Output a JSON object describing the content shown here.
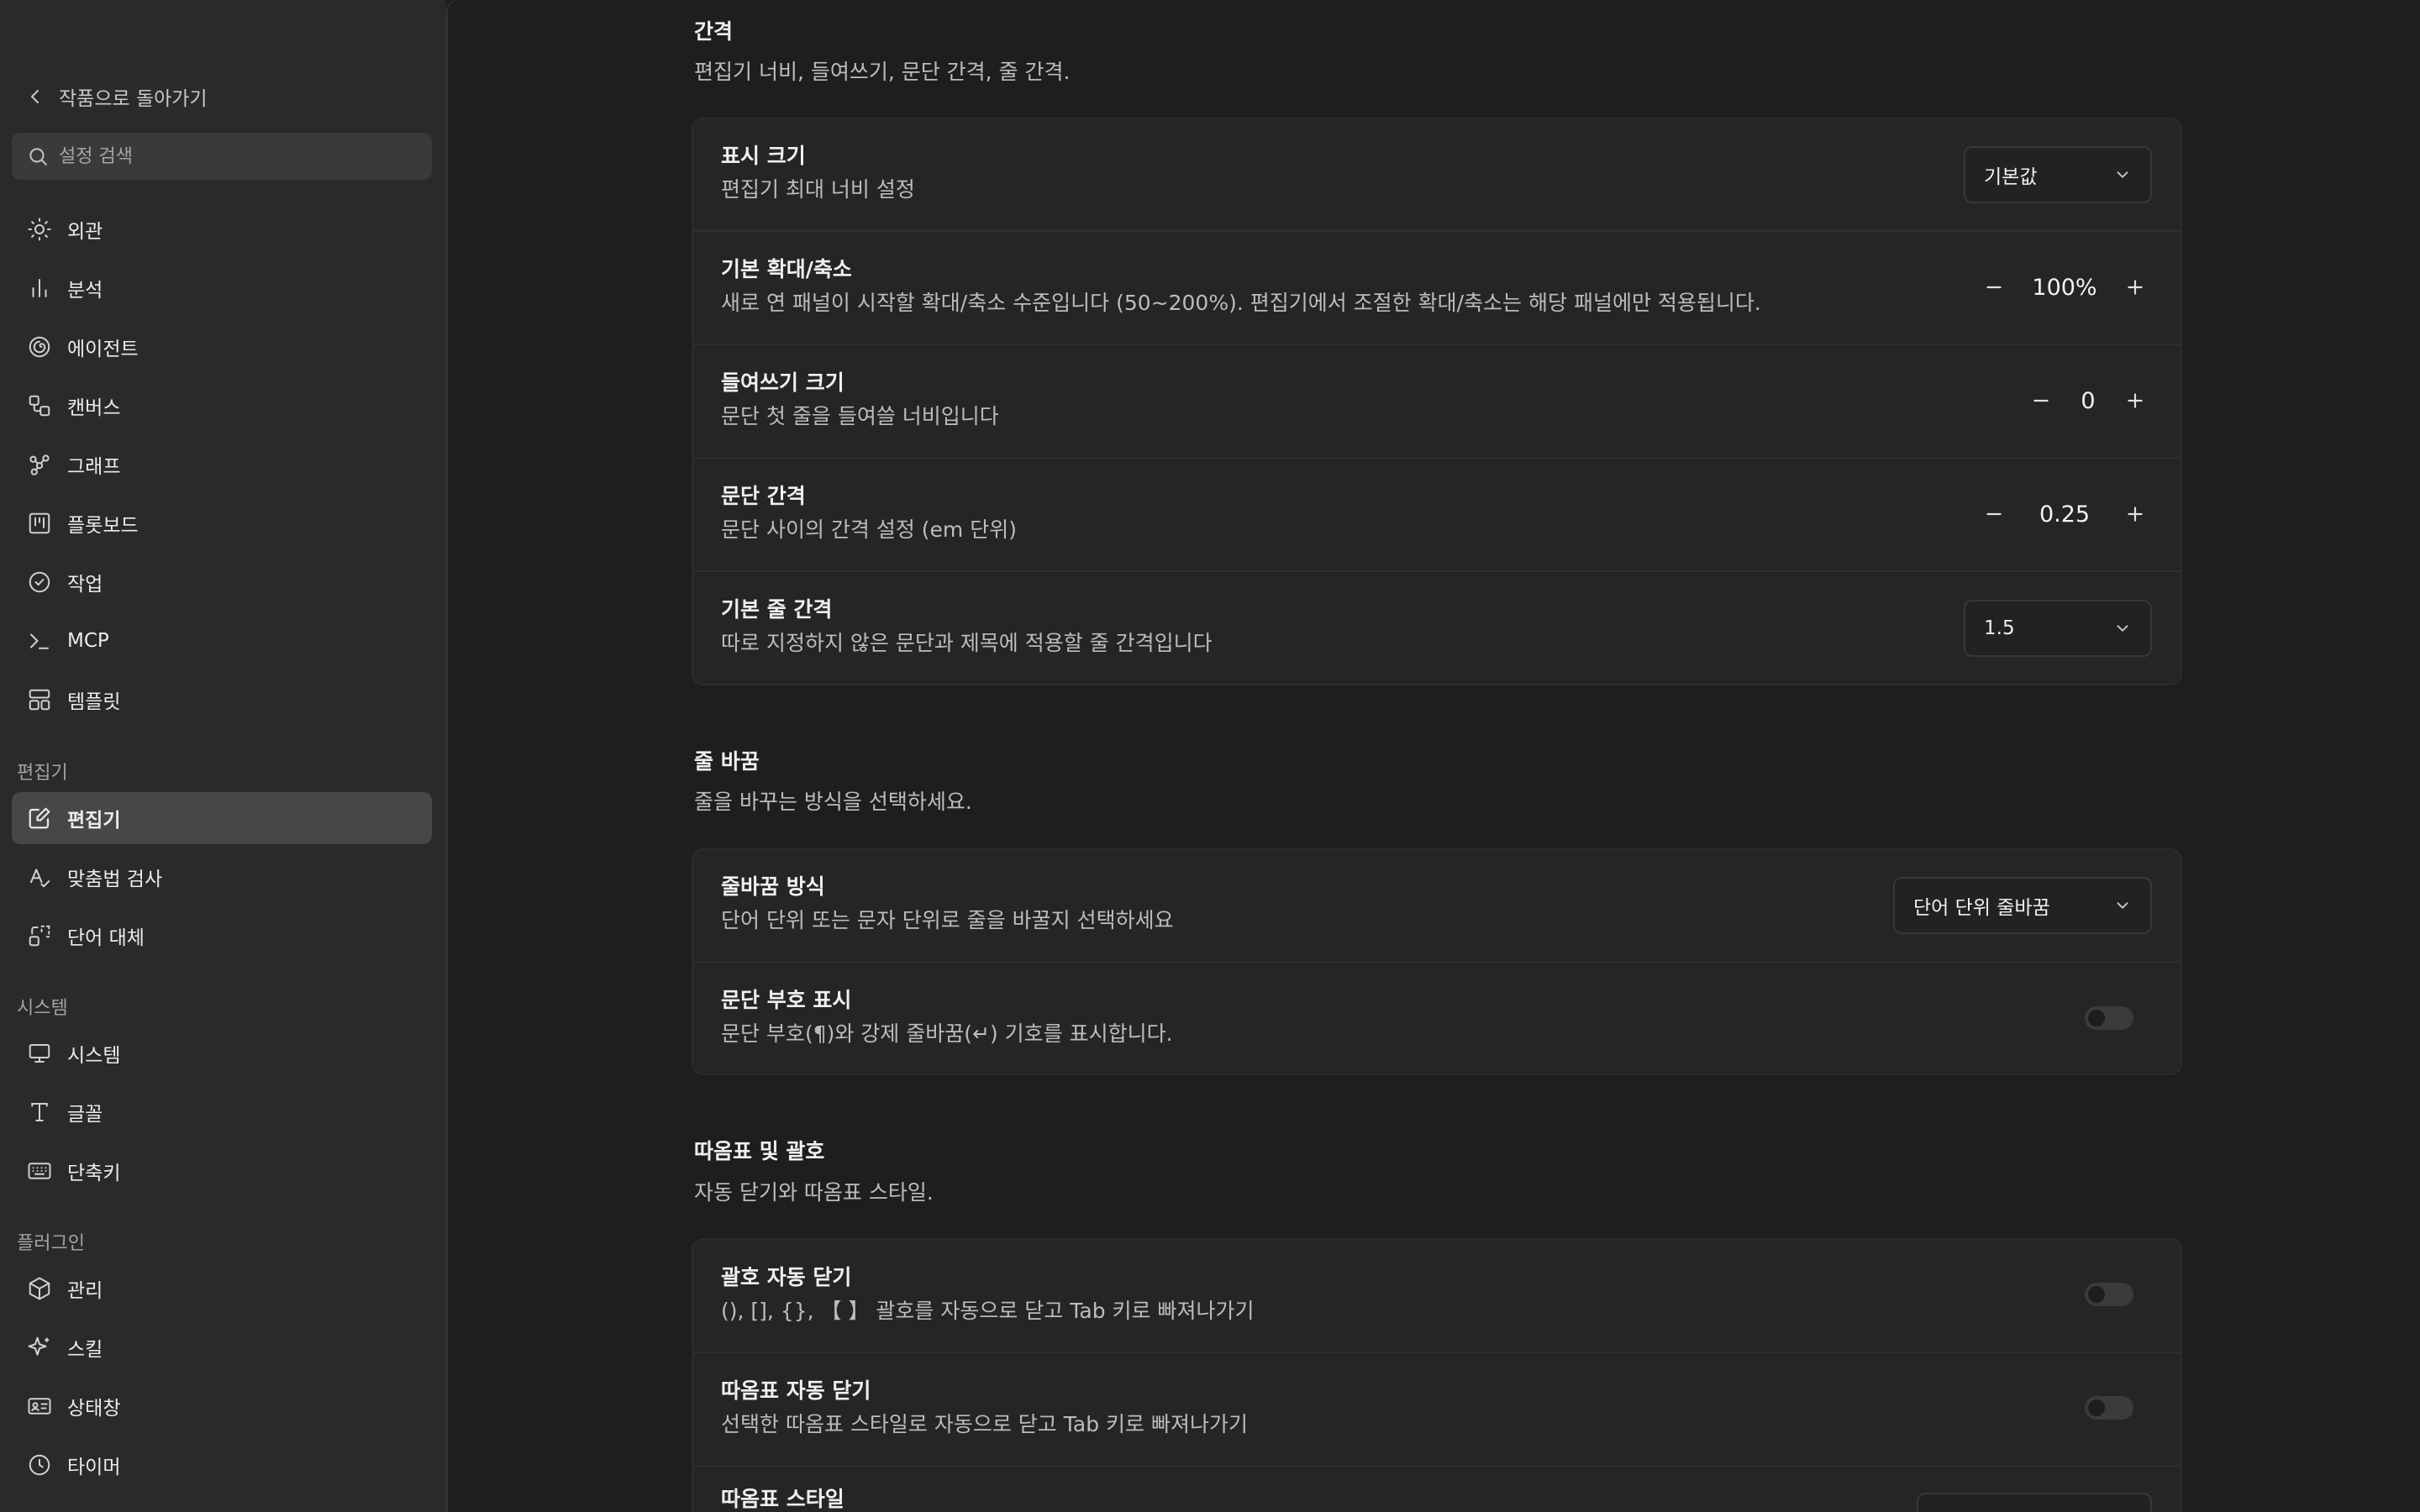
{
  "sidebar": {
    "back_label": "작품으로 돌아가기",
    "search_placeholder": "설정 검색",
    "items": [
      {
        "label": "외관",
        "icon": "sun-icon"
      },
      {
        "label": "분석",
        "icon": "bar-chart-icon"
      },
      {
        "label": "에이전트",
        "icon": "spiral-icon"
      },
      {
        "label": "캔버스",
        "icon": "canvas-icon"
      },
      {
        "label": "그래프",
        "icon": "graph-icon"
      },
      {
        "label": "플롯보드",
        "icon": "kanban-icon"
      },
      {
        "label": "작업",
        "icon": "check-circle-icon"
      },
      {
        "label": "MCP",
        "icon": "terminal-icon"
      },
      {
        "label": "템플릿",
        "icon": "layout-icon"
      }
    ],
    "groups": {
      "editor": {
        "label": "편집기",
        "items": [
          {
            "label": "편집기",
            "icon": "edit-icon",
            "active": true
          },
          {
            "label": "맞춤법 검사",
            "icon": "spellcheck-icon"
          },
          {
            "label": "단어 대체",
            "icon": "replace-icon"
          }
        ]
      },
      "system": {
        "label": "시스템",
        "items": [
          {
            "label": "시스템",
            "icon": "monitor-icon"
          },
          {
            "label": "글꼴",
            "icon": "type-icon"
          },
          {
            "label": "단축키",
            "icon": "keyboard-icon"
          }
        ]
      },
      "plugins": {
        "label": "플러그인",
        "items": [
          {
            "label": "관리",
            "icon": "package-icon"
          },
          {
            "label": "스킬",
            "icon": "sparkles-icon"
          },
          {
            "label": "상태창",
            "icon": "id-card-icon"
          },
          {
            "label": "타이머",
            "icon": "clock-icon"
          }
        ]
      }
    }
  },
  "spacing": {
    "title": "간격",
    "desc": "편집기 너비, 들여쓰기, 문단 간격, 줄 간격.",
    "display_size": {
      "title": "표시 크기",
      "desc": "편집기 최대 너비 설정",
      "value": "기본값"
    },
    "zoom": {
      "title": "기본 확대/축소",
      "desc": "새로 연 패널이 시작할 확대/축소 수준입니다 (50~200%). 편집기에서 조절한 확대/축소는 해당 패널에만 적용됩니다.",
      "value": "100%"
    },
    "indent": {
      "title": "들여쓰기 크기",
      "desc": "문단 첫 줄을 들여쓸 너비입니다",
      "value": "0"
    },
    "paragraph_spacing": {
      "title": "문단 간격",
      "desc": "문단 사이의 간격 설정 (em 단위)",
      "value": "0.25"
    },
    "line_height": {
      "title": "기본 줄 간격",
      "desc": "따로 지정하지 않은 문단과 제목에 적용할 줄 간격입니다",
      "value": "1.5"
    }
  },
  "wrap": {
    "title": "줄 바꿈",
    "desc": "줄을 바꾸는 방식을 선택하세요.",
    "mode": {
      "title": "줄바꿈 방식",
      "desc": "단어 단위 또는 문자 단위로 줄을 바꿀지 선택하세요",
      "value": "단어 단위 줄바꿈"
    },
    "marks": {
      "title": "문단 부호 표시",
      "desc": "문단 부호(¶)와 강제 줄바꿈(↵) 기호를 표시합니다.",
      "enabled": false
    }
  },
  "quotes": {
    "title": "따옴표 및 괄호",
    "desc": "자동 닫기와 따옴표 스타일.",
    "bracket_close": {
      "title": "괄호 자동 닫기",
      "desc": "(), [], {}, 【 】 괄호를 자동으로 닫고 Tab 키로 빠져나가기",
      "enabled": false
    },
    "quote_close": {
      "title": "따옴표 자동 닫기",
      "desc": "선택한 따옴표 스타일로 자동으로 닫고 Tab 키로 빠져나가기",
      "enabled": false
    },
    "quote_style": {
      "title": "따옴표 스타일"
    }
  }
}
